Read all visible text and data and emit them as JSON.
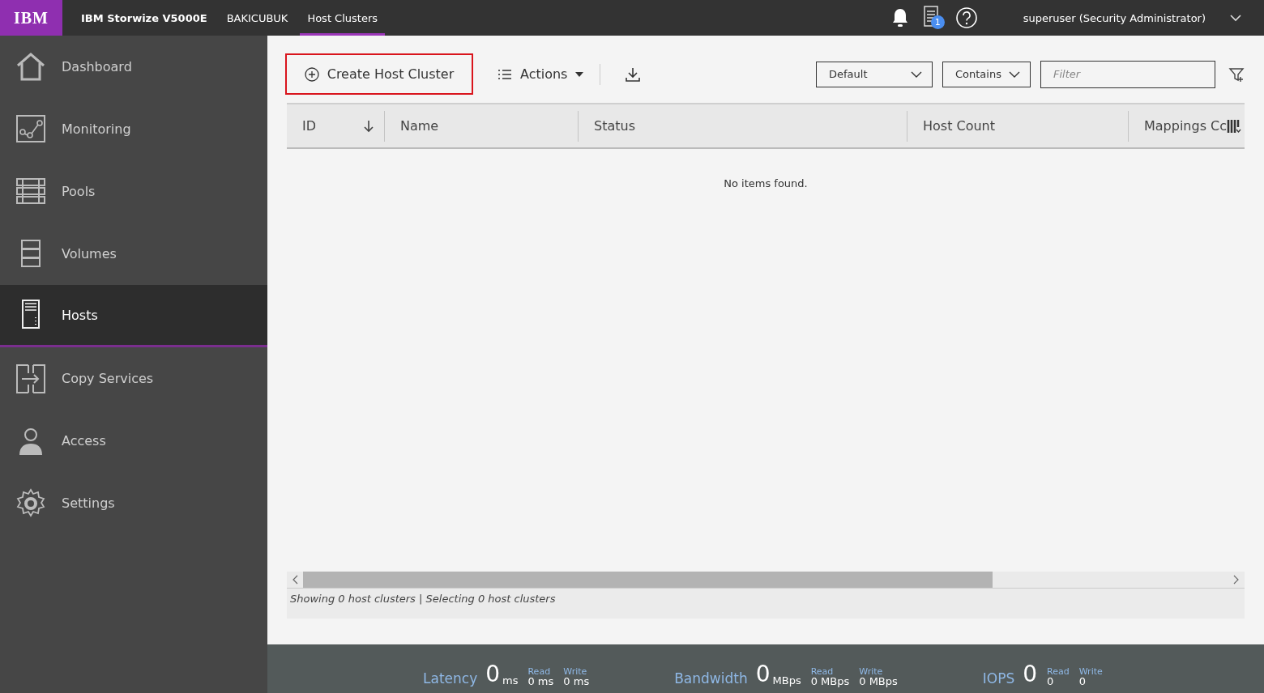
{
  "top_bar": {
    "logo": "IBM",
    "product": "IBM Storwize V5000E",
    "system": "BAKICUBUK",
    "page": "Host Clusters",
    "tasks_badge": "1",
    "user": "superuser (Security Administrator)"
  },
  "sidebar": {
    "items": [
      {
        "label": "Dashboard",
        "selected": false
      },
      {
        "label": "Monitoring",
        "selected": false
      },
      {
        "label": "Pools",
        "selected": false
      },
      {
        "label": "Volumes",
        "selected": false
      },
      {
        "label": "Hosts",
        "selected": true
      },
      {
        "label": "Copy Services",
        "selected": false
      },
      {
        "label": "Access",
        "selected": false
      },
      {
        "label": "Settings",
        "selected": false
      }
    ]
  },
  "toolbar": {
    "create_button": {
      "label": "Create Host Cluster",
      "highlighted": true
    },
    "actions": "Actions",
    "filter_scope": "Default",
    "filter_mode": "Contains",
    "filter": {
      "placeholder": "Filter"
    }
  },
  "table": {
    "columns": [
      {
        "label": "ID",
        "sorted": true
      },
      {
        "label": "Name",
        "sorted": false
      },
      {
        "label": "Status",
        "sorted": false
      },
      {
        "label": "Host Count",
        "sorted": false
      },
      {
        "label": "Mappings Cc",
        "sorted": false
      }
    ],
    "empty_message": "No items found.",
    "footer": "Showing 0 host clusters | Selecting 0 host clusters"
  },
  "performance": [
    {
      "label": "Latency",
      "value": "0",
      "unit": "ms",
      "read_label": "Read",
      "read": "0 ms",
      "write_label": "Write",
      "write": "0 ms"
    },
    {
      "label": "Bandwidth",
      "value": "0",
      "unit": "MBps",
      "read_label": "Read",
      "read": "0 MBps",
      "write_label": "Write",
      "write": "0 MBps"
    },
    {
      "label": "IOPS",
      "value": "0",
      "read_label": "Read",
      "read": "0",
      "write_label": "Write",
      "write": "0"
    }
  ]
}
